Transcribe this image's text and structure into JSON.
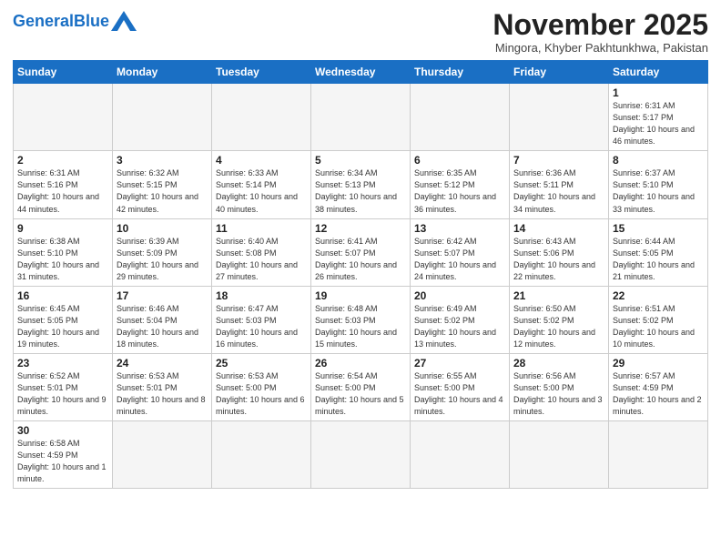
{
  "header": {
    "logo_general": "General",
    "logo_blue": "Blue",
    "month_title": "November 2025",
    "location": "Mingora, Khyber Pakhtunkhwa, Pakistan"
  },
  "weekdays": [
    "Sunday",
    "Monday",
    "Tuesday",
    "Wednesday",
    "Thursday",
    "Friday",
    "Saturday"
  ],
  "weeks": [
    [
      {
        "day": "",
        "info": ""
      },
      {
        "day": "",
        "info": ""
      },
      {
        "day": "",
        "info": ""
      },
      {
        "day": "",
        "info": ""
      },
      {
        "day": "",
        "info": ""
      },
      {
        "day": "",
        "info": ""
      },
      {
        "day": "1",
        "info": "Sunrise: 6:31 AM\nSunset: 5:17 PM\nDaylight: 10 hours and 46 minutes."
      }
    ],
    [
      {
        "day": "2",
        "info": "Sunrise: 6:31 AM\nSunset: 5:16 PM\nDaylight: 10 hours and 44 minutes."
      },
      {
        "day": "3",
        "info": "Sunrise: 6:32 AM\nSunset: 5:15 PM\nDaylight: 10 hours and 42 minutes."
      },
      {
        "day": "4",
        "info": "Sunrise: 6:33 AM\nSunset: 5:14 PM\nDaylight: 10 hours and 40 minutes."
      },
      {
        "day": "5",
        "info": "Sunrise: 6:34 AM\nSunset: 5:13 PM\nDaylight: 10 hours and 38 minutes."
      },
      {
        "day": "6",
        "info": "Sunrise: 6:35 AM\nSunset: 5:12 PM\nDaylight: 10 hours and 36 minutes."
      },
      {
        "day": "7",
        "info": "Sunrise: 6:36 AM\nSunset: 5:11 PM\nDaylight: 10 hours and 34 minutes."
      },
      {
        "day": "8",
        "info": "Sunrise: 6:37 AM\nSunset: 5:10 PM\nDaylight: 10 hours and 33 minutes."
      }
    ],
    [
      {
        "day": "9",
        "info": "Sunrise: 6:38 AM\nSunset: 5:10 PM\nDaylight: 10 hours and 31 minutes."
      },
      {
        "day": "10",
        "info": "Sunrise: 6:39 AM\nSunset: 5:09 PM\nDaylight: 10 hours and 29 minutes."
      },
      {
        "day": "11",
        "info": "Sunrise: 6:40 AM\nSunset: 5:08 PM\nDaylight: 10 hours and 27 minutes."
      },
      {
        "day": "12",
        "info": "Sunrise: 6:41 AM\nSunset: 5:07 PM\nDaylight: 10 hours and 26 minutes."
      },
      {
        "day": "13",
        "info": "Sunrise: 6:42 AM\nSunset: 5:07 PM\nDaylight: 10 hours and 24 minutes."
      },
      {
        "day": "14",
        "info": "Sunrise: 6:43 AM\nSunset: 5:06 PM\nDaylight: 10 hours and 22 minutes."
      },
      {
        "day": "15",
        "info": "Sunrise: 6:44 AM\nSunset: 5:05 PM\nDaylight: 10 hours and 21 minutes."
      }
    ],
    [
      {
        "day": "16",
        "info": "Sunrise: 6:45 AM\nSunset: 5:05 PM\nDaylight: 10 hours and 19 minutes."
      },
      {
        "day": "17",
        "info": "Sunrise: 6:46 AM\nSunset: 5:04 PM\nDaylight: 10 hours and 18 minutes."
      },
      {
        "day": "18",
        "info": "Sunrise: 6:47 AM\nSunset: 5:03 PM\nDaylight: 10 hours and 16 minutes."
      },
      {
        "day": "19",
        "info": "Sunrise: 6:48 AM\nSunset: 5:03 PM\nDaylight: 10 hours and 15 minutes."
      },
      {
        "day": "20",
        "info": "Sunrise: 6:49 AM\nSunset: 5:02 PM\nDaylight: 10 hours and 13 minutes."
      },
      {
        "day": "21",
        "info": "Sunrise: 6:50 AM\nSunset: 5:02 PM\nDaylight: 10 hours and 12 minutes."
      },
      {
        "day": "22",
        "info": "Sunrise: 6:51 AM\nSunset: 5:02 PM\nDaylight: 10 hours and 10 minutes."
      }
    ],
    [
      {
        "day": "23",
        "info": "Sunrise: 6:52 AM\nSunset: 5:01 PM\nDaylight: 10 hours and 9 minutes."
      },
      {
        "day": "24",
        "info": "Sunrise: 6:53 AM\nSunset: 5:01 PM\nDaylight: 10 hours and 8 minutes."
      },
      {
        "day": "25",
        "info": "Sunrise: 6:53 AM\nSunset: 5:00 PM\nDaylight: 10 hours and 6 minutes."
      },
      {
        "day": "26",
        "info": "Sunrise: 6:54 AM\nSunset: 5:00 PM\nDaylight: 10 hours and 5 minutes."
      },
      {
        "day": "27",
        "info": "Sunrise: 6:55 AM\nSunset: 5:00 PM\nDaylight: 10 hours and 4 minutes."
      },
      {
        "day": "28",
        "info": "Sunrise: 6:56 AM\nSunset: 5:00 PM\nDaylight: 10 hours and 3 minutes."
      },
      {
        "day": "29",
        "info": "Sunrise: 6:57 AM\nSunset: 4:59 PM\nDaylight: 10 hours and 2 minutes."
      }
    ],
    [
      {
        "day": "30",
        "info": "Sunrise: 6:58 AM\nSunset: 4:59 PM\nDaylight: 10 hours and 1 minute."
      },
      {
        "day": "",
        "info": ""
      },
      {
        "day": "",
        "info": ""
      },
      {
        "day": "",
        "info": ""
      },
      {
        "day": "",
        "info": ""
      },
      {
        "day": "",
        "info": ""
      },
      {
        "day": "",
        "info": ""
      }
    ]
  ]
}
